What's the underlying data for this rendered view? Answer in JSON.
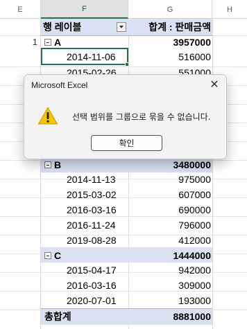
{
  "columns": {
    "e": "E",
    "f": "F",
    "g": "G",
    "h": "H"
  },
  "pivot": {
    "row_label_header": "행 레이블",
    "value_header": "합계 : 판매금액",
    "row_number": "1",
    "groups": [
      {
        "label": "A",
        "total": "3957000",
        "rows": [
          {
            "date": "2014-11-06",
            "value": "516000"
          },
          {
            "date": "2015-02-26",
            "value": "551000"
          }
        ]
      },
      {
        "label": "B",
        "total": "3480000",
        "rows": [
          {
            "date": "2014-11-13",
            "value": "975000"
          },
          {
            "date": "2015-03-02",
            "value": "607000"
          },
          {
            "date": "2016-03-16",
            "value": "690000"
          },
          {
            "date": "2016-11-24",
            "value": "796000"
          },
          {
            "date": "2019-08-28",
            "value": "412000"
          }
        ]
      },
      {
        "label": "C",
        "total": "1444000",
        "rows": [
          {
            "date": "2015-04-17",
            "value": "942000"
          },
          {
            "date": "2016-03-16",
            "value": "309000"
          },
          {
            "date": "2020-07-01",
            "value": "193000"
          }
        ]
      }
    ],
    "grand_total_label": "총합계",
    "grand_total_value": "8881000"
  },
  "dialog": {
    "title": "Microsoft Excel",
    "message": "선택 범위를 그룹으로 묶을 수 없습니다.",
    "ok_label": "확인",
    "close_glyph": "✕",
    "icon": "warning-icon"
  },
  "colors": {
    "header_band": "#d9e1f2",
    "selection_green": "#217346",
    "warning_yellow": "#f5c400"
  }
}
